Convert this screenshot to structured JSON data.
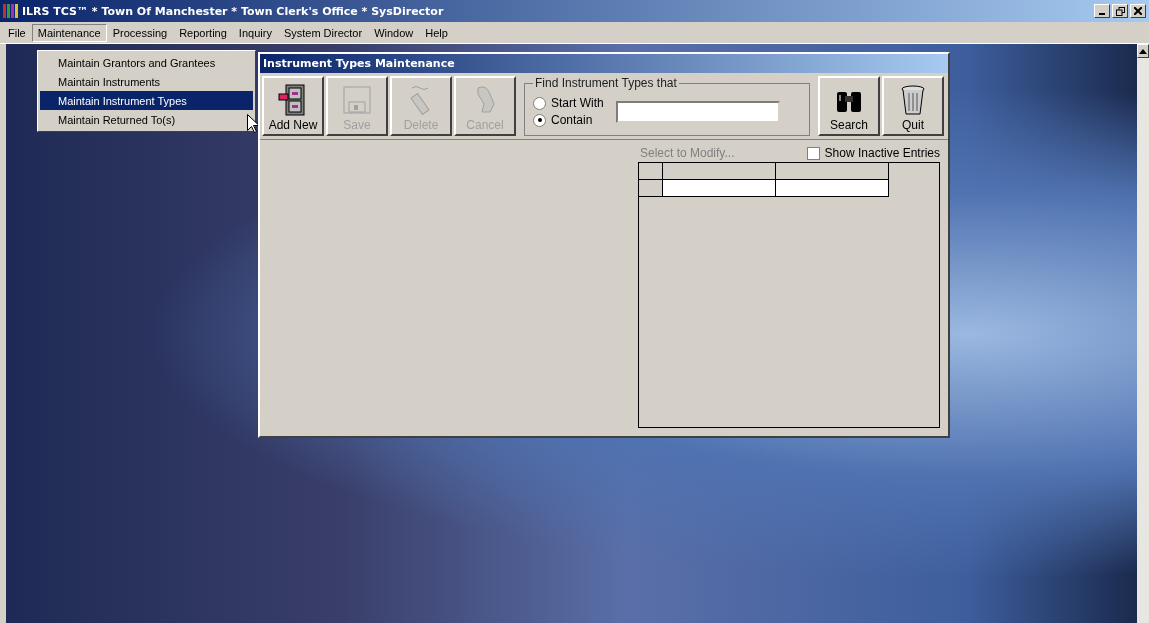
{
  "app_window": {
    "title": "ILRS TCS™ * Town Of Manchester * Town Clerk's Office * SysDirector"
  },
  "menu_bar": [
    {
      "label": "File",
      "selected": false
    },
    {
      "label": "Maintenance",
      "selected": true
    },
    {
      "label": "Processing",
      "selected": false
    },
    {
      "label": "Reporting",
      "selected": false
    },
    {
      "label": "Inquiry",
      "selected": false
    },
    {
      "label": "System Director",
      "selected": false
    },
    {
      "label": "Window",
      "selected": false
    },
    {
      "label": "Help",
      "selected": false
    }
  ],
  "dropdown_menu": [
    {
      "label": "Maintain Grantors and Grantees",
      "selected": false
    },
    {
      "label": "Maintain Instruments",
      "selected": false
    },
    {
      "label": "Maintain Instrument Types",
      "selected": true
    },
    {
      "label": "Maintain Returned To(s)",
      "selected": false
    }
  ],
  "child_window": {
    "title": "Instrument Types Maintenance",
    "left_buttons": [
      {
        "label": "Add New",
        "kind": "add",
        "disabled": false
      },
      {
        "label": "Save",
        "kind": "save",
        "disabled": true
      },
      {
        "label": "Delete",
        "kind": "delete",
        "disabled": true
      },
      {
        "label": "Cancel",
        "kind": "cancel",
        "disabled": true
      }
    ],
    "find_group": {
      "legend": "Find Instrument Types that",
      "options": [
        {
          "label": "Start With",
          "selected": false
        },
        {
          "label": "Contain",
          "selected": true
        }
      ]
    },
    "right_buttons": [
      {
        "label": "Search",
        "kind": "search",
        "disabled": false
      },
      {
        "label": "Quit",
        "kind": "quit",
        "disabled": false
      }
    ],
    "list_label": "Select to Modify...",
    "show_inactive": {
      "label": "Show Inactive Entries",
      "checked": false
    }
  }
}
